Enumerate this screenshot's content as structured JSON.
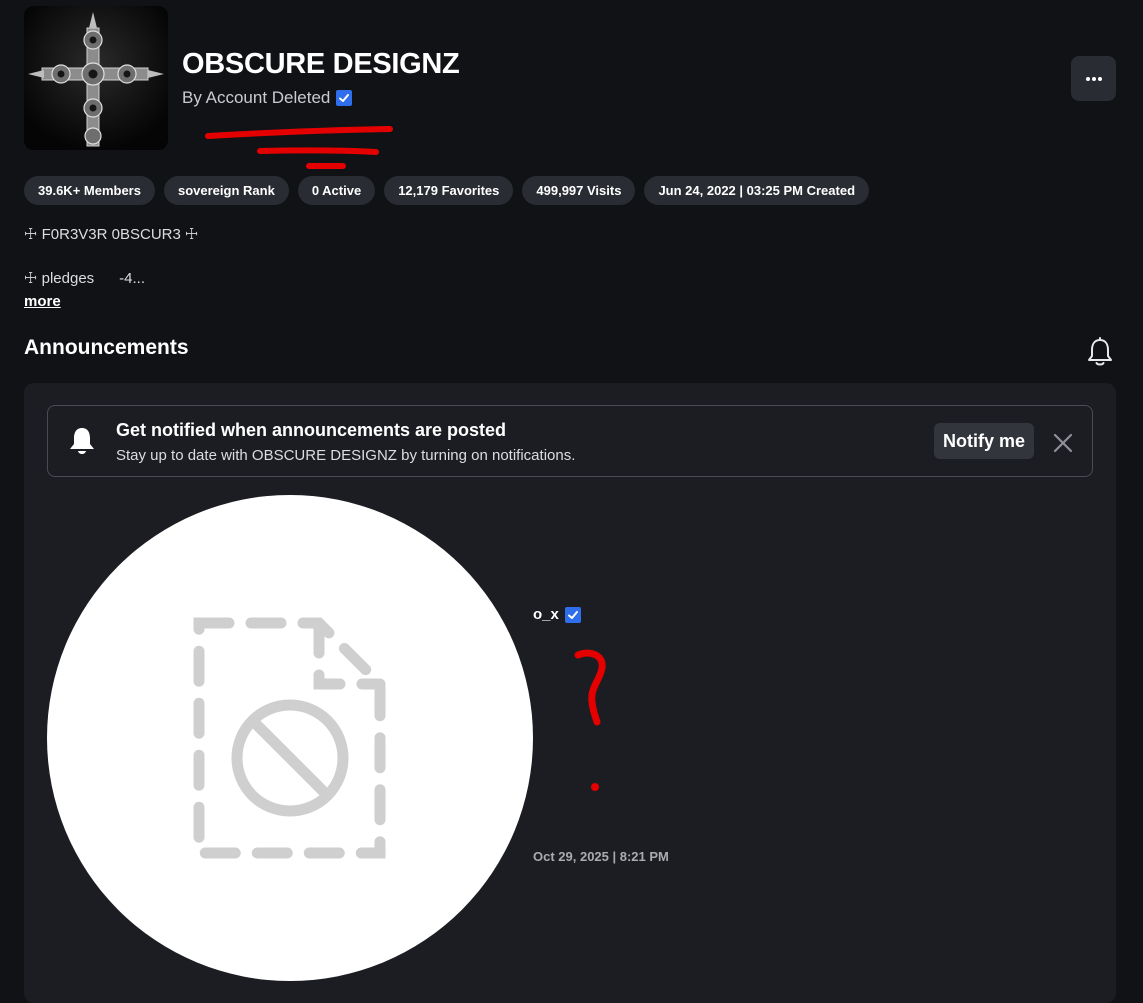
{
  "group": {
    "name": "OBSCURE DESIGNZ",
    "owner_line": "By Account Deleted",
    "icon": "gothic-cross-icon"
  },
  "stats": [
    {
      "label": "39.6K+ Members"
    },
    {
      "label": "sovereign Rank"
    },
    {
      "label": "0 Active"
    },
    {
      "label": "12,179 Favorites"
    },
    {
      "label": "499,997 Visits"
    },
    {
      "label": "Jun 24, 2022 | 03:25 PM Created"
    }
  ],
  "description": {
    "line1": "☩ F0R3V3R 0BSCUR3 ☩",
    "line2": "☩ pledges      -4...",
    "more_label": "more"
  },
  "announcements": {
    "title": "Announcements",
    "banner": {
      "title": "Get notified when announcements are posted",
      "subtitle": "Stay up to date with OBSCURE DESIGNZ by turning on notifications.",
      "button_label": "Notify me"
    },
    "post": {
      "author": "o_x",
      "timestamp": "Oct 29, 2025 | 8:21 PM",
      "image": "broken-file-icon"
    }
  },
  "colors": {
    "background": "#111216",
    "panel": "#1c1d22",
    "pill": "#2a2c33",
    "verified": "#2f6fed",
    "scribble": "#e50000"
  }
}
